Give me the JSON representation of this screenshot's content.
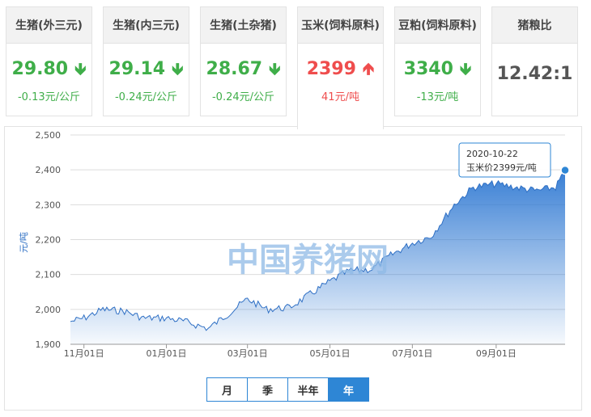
{
  "cards": [
    {
      "title": "生猪(外三元)",
      "price": "29.80",
      "change": "-0.13元/公斤",
      "dir": "down"
    },
    {
      "title": "生猪(内三元)",
      "price": "29.14",
      "change": "-0.24元/公斤",
      "dir": "down"
    },
    {
      "title": "生猪(土杂猪)",
      "price": "28.67",
      "change": "-0.24元/公斤",
      "dir": "down"
    },
    {
      "title": "玉米(饲料原料)",
      "price": "2399",
      "change": "41元/吨",
      "dir": "up"
    },
    {
      "title": "豆粕(饲料原料)",
      "price": "3340",
      "change": "-13元/吨",
      "dir": "down"
    },
    {
      "title": "猪粮比",
      "price": "12.42:1",
      "change": "",
      "dir": "none"
    }
  ],
  "arrows": {
    "down": "🡻",
    "up": "🡹"
  },
  "watermark": "中国养猪网",
  "tooltip": {
    "date": "2020-10-22",
    "text": "玉米价2399元/吨"
  },
  "range_buttons": [
    "月",
    "季",
    "半年",
    "年"
  ],
  "range_selected": 3,
  "colors": {
    "green": "#3fae49",
    "red": "#ef4d4d",
    "line": "#2e6fc4",
    "fillTop": "#2e78d2",
    "accent": "#2e86d5"
  },
  "chart_data": {
    "type": "area",
    "title": "",
    "xlabel": "",
    "ylabel": "元/吨",
    "ylim": [
      1900,
      2500
    ],
    "yticks": [
      1900,
      2000,
      2100,
      2200,
      2300,
      2400,
      2500
    ],
    "ytick_labels": [
      "1,900",
      "2,000",
      "2,100",
      "2,200",
      "2,300",
      "2,400",
      "2,500"
    ],
    "xtick_labels": [
      "11月01日",
      "01月01日",
      "03月01日",
      "05月01日",
      "07月01日",
      "09月01日"
    ],
    "xlim": [
      "2019-10-22",
      "2020-10-22"
    ],
    "grid": true,
    "series": [
      {
        "name": "",
        "x": [
          "2019-10-22",
          "2019-11-01",
          "2019-11-15",
          "2019-12-01",
          "2019-12-15",
          "2020-01-01",
          "2020-01-15",
          "2020-02-01",
          "2020-02-15",
          "2020-03-01",
          "2020-03-15",
          "2020-04-01",
          "2020-04-15",
          "2020-05-01",
          "2020-05-15",
          "2020-06-01",
          "2020-06-15",
          "2020-07-01",
          "2020-07-15",
          "2020-08-01",
          "2020-08-15",
          "2020-09-01",
          "2020-09-15",
          "2020-10-01",
          "2020-10-15",
          "2020-10-22"
        ],
        "y": [
          1965,
          1975,
          2000,
          1995,
          1975,
          1975,
          1965,
          1945,
          1985,
          2030,
          2000,
          2005,
          2040,
          2080,
          2110,
          2115,
          2155,
          2190,
          2210,
          2300,
          2350,
          2360,
          2350,
          2340,
          2350,
          2399
        ]
      }
    ]
  }
}
